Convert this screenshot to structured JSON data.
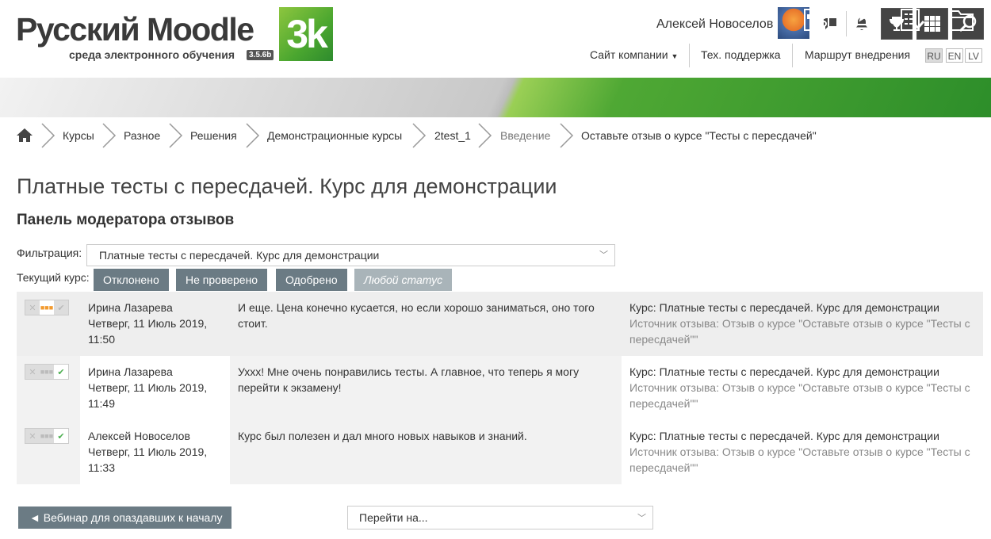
{
  "brand": {
    "logo_text": "Русский Moodle",
    "subtitle": "среда электронного обучения",
    "version": "3.5.6b",
    "badge": "3k",
    "accent": "#5aa632",
    "button_dark": "#444444",
    "button_gray": "#6b7b84"
  },
  "header": {
    "user_name": "Алексей Новоселов",
    "nav": {
      "company": "Сайт компании",
      "support": "Тех. поддержка",
      "roadmap": "Маршрут внедрения"
    },
    "languages": [
      "RU",
      "EN",
      "LV"
    ]
  },
  "breadcrumb": [
    "Курсы",
    "Разное",
    "Решения",
    "Демонстрационные курсы",
    "2test_1",
    "Введение",
    "Оставьте отзыв о курсе \"Тесты с пересдачей\""
  ],
  "page": {
    "title": "Платные тесты с пересдачей. Курс для демонстрации",
    "panel_title": "Панель модератора отзывов",
    "filter_label": "Фильтрация:",
    "filter_value": "Платные тесты с пересдачей. Курс для демонстрации",
    "course_label": "Текущий курс:",
    "status_filters": {
      "rejected": "Отклонено",
      "unchecked": "Не проверено",
      "approved": "Одобрено",
      "any": "Любой статус"
    }
  },
  "reviews": [
    {
      "author": "Ирина Лазарева",
      "date": "Четверг, 11 Июль 2019, 11:50",
      "text": "И еще. Цена конечно кусается, но если хорошо заниматься, оно того стоит.",
      "course": "Курс: Платные тесты с пересдачей. Курс для демонстрации",
      "source": "Источник отзыва: Отзыв о курсе \"Оставьте отзыв о курсе \"Тесты с пересдачей\"\""
    },
    {
      "author": "Ирина Лазарева",
      "date": "Четверг, 11 Июль 2019, 11:49",
      "text": "Уххх! Мне очень понравились тесты. А главное, что теперь я могу перейти к экзамену!",
      "course": "Курс: Платные тесты с пересдачей. Курс для демонстрации",
      "source": "Источник отзыва: Отзыв о курсе \"Оставьте отзыв о курсе \"Тесты с пересдачей\"\""
    },
    {
      "author": "Алексей Новоселов",
      "date": "Четверг, 11 Июль 2019, 11:33",
      "text": "Курс был полезен и дал много новых навыков и знаний.",
      "course": "Курс: Платные тесты с пересдачей. Курс для демонстрации",
      "source": "Источник отзыва: Отзыв о курсе \"Оставьте отзыв о курсе \"Тесты с пересдачей\"\""
    }
  ],
  "footer": {
    "prev_link": "◄ Вебинар для опаздавших к началу",
    "jump_placeholder": "Перейти на..."
  }
}
